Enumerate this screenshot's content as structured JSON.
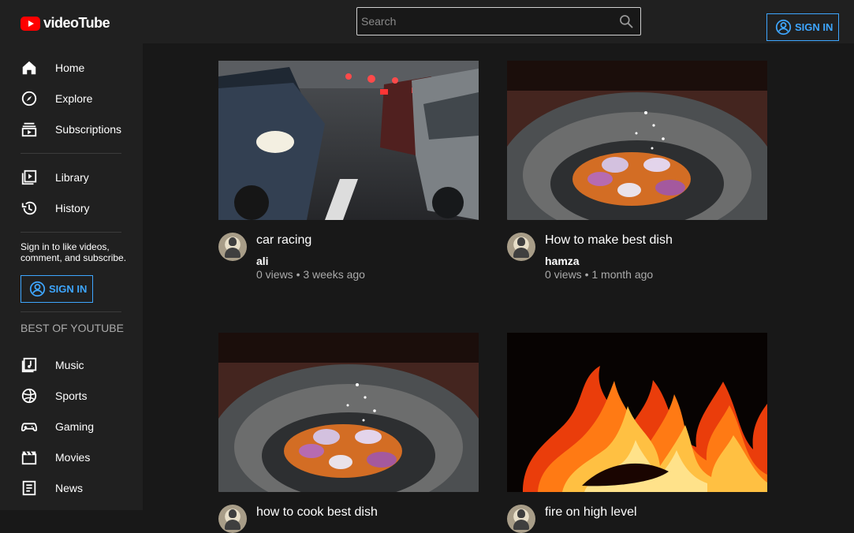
{
  "header": {
    "logo_text": "videoTube",
    "search_placeholder": "Search",
    "sign_in_label": "SIGN IN"
  },
  "sidebar": {
    "primary": [
      {
        "label": "Home",
        "icon": "home-icon"
      },
      {
        "label": "Explore",
        "icon": "explore-icon"
      },
      {
        "label": "Subscriptions",
        "icon": "subscriptions-icon"
      }
    ],
    "library": [
      {
        "label": "Library",
        "icon": "library-icon"
      },
      {
        "label": "History",
        "icon": "history-icon"
      }
    ],
    "sign_in_text": "Sign in to like videos, comment, and subscribe.",
    "sign_in_label": "SIGN IN",
    "best_heading": "BEST OF YOUTUBE",
    "best": [
      {
        "label": "Music",
        "icon": "music-icon"
      },
      {
        "label": "Sports",
        "icon": "sports-icon"
      },
      {
        "label": "Gaming",
        "icon": "gaming-icon"
      },
      {
        "label": "Movies",
        "icon": "movies-icon"
      },
      {
        "label": "News",
        "icon": "news-icon"
      }
    ]
  },
  "videos": [
    {
      "title": "car racing",
      "channel": "ali",
      "meta": "0 views • 3 weeks ago",
      "thumbnail": "city-traffic-thumbnail"
    },
    {
      "title": "How to make best dish",
      "channel": "hamza",
      "meta": "0 views • 1 month ago",
      "thumbnail": "stone-bowl-dish-thumbnail"
    },
    {
      "title": "how to cook best dish",
      "channel": "",
      "meta": "",
      "thumbnail": "stone-bowl-dish-thumbnail"
    },
    {
      "title": "fire on high level",
      "channel": "",
      "meta": "",
      "thumbnail": "fire-thumbnail"
    }
  ],
  "colors": {
    "background": "#181818",
    "panel": "#202020",
    "accent": "#3ea6ff",
    "logo_red": "#ff0000"
  }
}
